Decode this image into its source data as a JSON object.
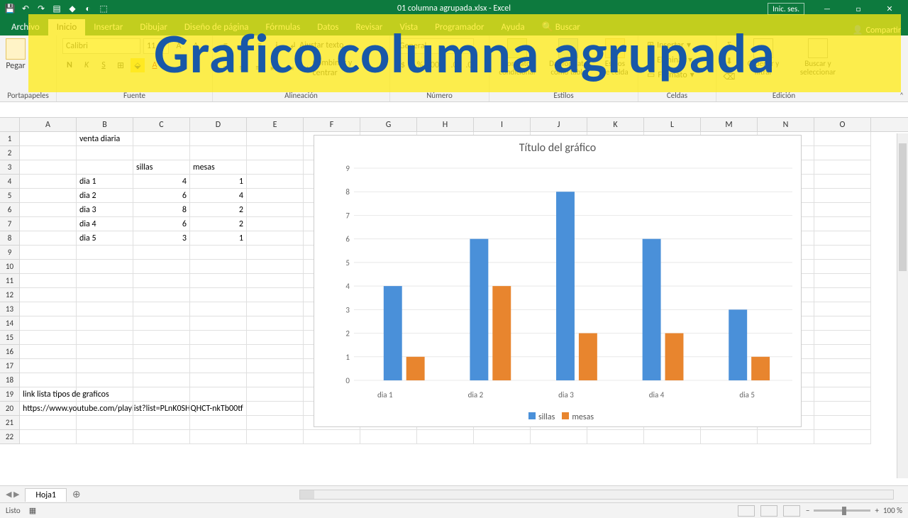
{
  "app": {
    "title_file": "01 columna agrupada.xlsx",
    "title_app": "Excel",
    "signin": "Inic. ses.",
    "share": "Compartir"
  },
  "tabs": {
    "file": "Archivo",
    "inicio": "Inicio",
    "insertar": "Insertar",
    "dibujar": "Dibujar",
    "diseno": "Diseño de página",
    "formulas": "Fórmulas",
    "datos": "Datos",
    "revisar": "Revisar",
    "vista": "Vista",
    "programador": "Programador",
    "ayuda": "Ayuda",
    "buscar": "Buscar"
  },
  "ribbon": {
    "paste": "Pegar",
    "portapapeles": "Portapapeles",
    "fuente_name": "Calibri",
    "fuente_size": "11",
    "fuente": "Fuente",
    "ajustar": "Ajustar texto",
    "combinar": "Combinar y centrar",
    "alineacion": "Alineación",
    "formato_num": "General",
    "numero": "Número",
    "formato_cond": "Formato condicional",
    "dar_formato": "Dar formato como tabla",
    "estilos_celda": "Estilos de celda",
    "estilos": "Estilos",
    "insertar_c": "Insertar",
    "eliminar_c": "Eliminar",
    "formato_c": "Formato",
    "celdas": "Celdas",
    "ordenar": "Ordenar y filtrar",
    "buscar_sel": "Buscar y seleccionar",
    "edicion": "Edición"
  },
  "columns": [
    "A",
    "B",
    "C",
    "D",
    "E",
    "F",
    "G",
    "H",
    "I",
    "J",
    "K",
    "L",
    "M",
    "N",
    "O"
  ],
  "sheet": {
    "b1": "venta diaria",
    "c3": "sillas",
    "d3": "mesas",
    "rows": [
      {
        "b": "dia 1",
        "c": "4",
        "d": "1"
      },
      {
        "b": "dia 2",
        "c": "6",
        "d": "4"
      },
      {
        "b": "dia 3",
        "c": "8",
        "d": "2"
      },
      {
        "b": "dia 4",
        "c": "6",
        "d": "2"
      },
      {
        "b": "dia 5",
        "c": "3",
        "d": "1"
      }
    ],
    "a19": "link lista tipos de graficos",
    "a20": "https://www.youtube.com/playlist?list=PLnK0SHQHCT-nkTb00tf",
    "tabname": "Hoja1"
  },
  "chart_data": {
    "type": "bar",
    "title": "Título del gráfico",
    "categories": [
      "dia 1",
      "dia 2",
      "dia 3",
      "dia 4",
      "dia 5"
    ],
    "series": [
      {
        "name": "sillas",
        "color": "#4a90d9",
        "values": [
          4,
          6,
          8,
          6,
          3
        ]
      },
      {
        "name": "mesas",
        "color": "#e8852e",
        "values": [
          1,
          4,
          2,
          2,
          1
        ]
      }
    ],
    "ylim": [
      0,
      9
    ],
    "yticks": [
      0,
      1,
      2,
      3,
      4,
      5,
      6,
      7,
      8,
      9
    ]
  },
  "status": {
    "listo": "Listo",
    "zoom": "100 %"
  },
  "banner": "Grafico columna agrupada"
}
